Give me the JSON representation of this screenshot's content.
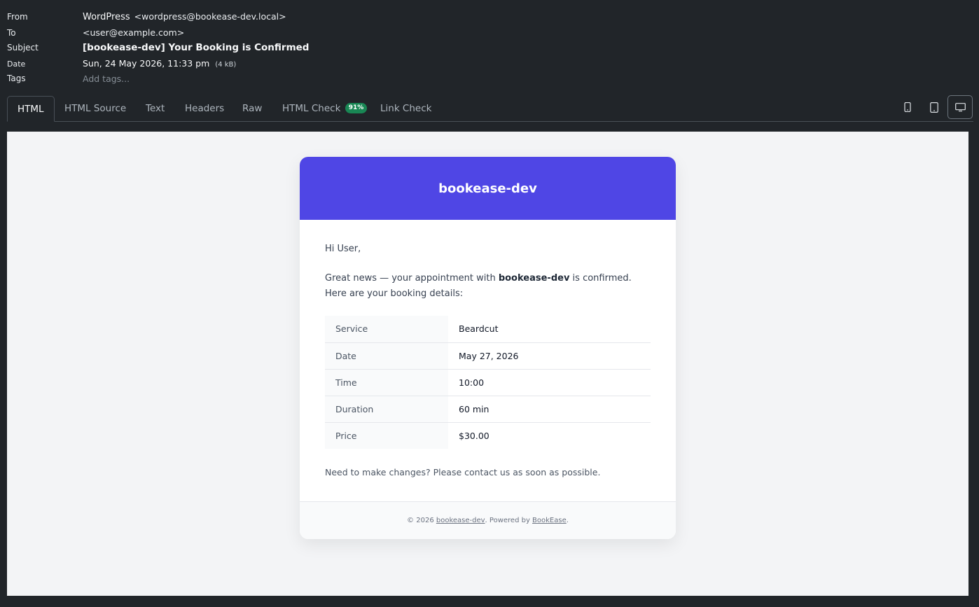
{
  "headers": {
    "from_label": "From",
    "from_name": "WordPress",
    "from_addr": "<wordpress@bookease-dev.local>",
    "to_label": "To",
    "to_addr": "<user@example.com>",
    "subject_label": "Subject",
    "subject": "[bookease-dev] Your Booking is Confirmed",
    "date_label": "Date",
    "date": "Sun, 24 May 2026, 11:33 pm",
    "size": "(4 kB)",
    "tags_label": "Tags",
    "tags_placeholder": "Add tags..."
  },
  "tabs": [
    {
      "label": "HTML",
      "active": true
    },
    {
      "label": "HTML Source"
    },
    {
      "label": "Text"
    },
    {
      "label": "Headers"
    },
    {
      "label": "Raw"
    },
    {
      "label": "HTML Check",
      "badge": "91%"
    },
    {
      "label": "Link Check"
    }
  ],
  "view_modes": [
    {
      "icon": "phone-icon"
    },
    {
      "icon": "tablet-icon"
    },
    {
      "icon": "desktop-icon",
      "active": true
    }
  ],
  "email": {
    "brand": "bookease-dev",
    "brand_color": "#4f46e5",
    "greeting": "Hi User,",
    "intro_pre": "Great news — your appointment with ",
    "intro_brand": "bookease-dev",
    "intro_post": " is confirmed. Here are your booking details:",
    "details": [
      {
        "key": "Service",
        "value": "Beardcut"
      },
      {
        "key": "Date",
        "value": "May 27, 2026"
      },
      {
        "key": "Time",
        "value": "10:00"
      },
      {
        "key": "Duration",
        "value": "60 min"
      },
      {
        "key": "Price",
        "value": "$30.00"
      }
    ],
    "changes": "Need to make changes? Please contact us as soon as possible.",
    "footer_copy": "© 2026 ",
    "footer_brand": "bookease-dev",
    "footer_mid": ". Powered by ",
    "footer_powered": "BookEase",
    "footer_end": "."
  }
}
